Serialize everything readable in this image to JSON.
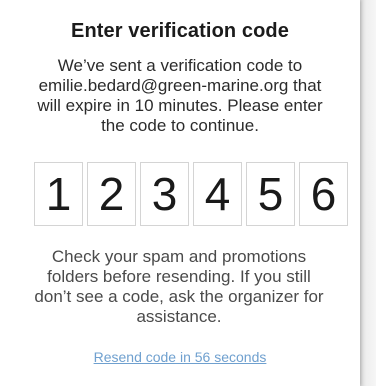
{
  "dialog": {
    "title": "Enter verification code",
    "message_line1": "We’ve sent a verification code to",
    "email": "emilie.bedard@green-marine.org",
    "message_line2_suffix": " that",
    "message_line3": "will expire in 10 minutes. Please enter",
    "message_line4": "the code to continue.",
    "code_digits": [
      "1",
      "2",
      "3",
      "4",
      "5",
      "6"
    ],
    "help_line1": "Check your spam and promotions",
    "help_line2": "folders before resending. If you still",
    "help_line3": "don’t see a code, ask the organizer for",
    "help_line4": "assistance.",
    "resend_label": "Resend code in 56 seconds"
  },
  "colors": {
    "link": "#6fa0cf",
    "text": "#2b2b2b",
    "digit_border": "#d4d4d4"
  }
}
